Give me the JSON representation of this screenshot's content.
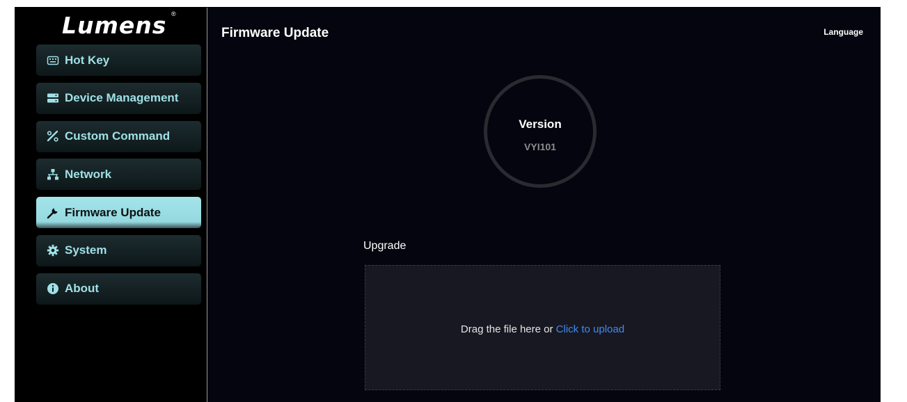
{
  "logo": {
    "text": "Lumens",
    "reg": "®"
  },
  "sidebar": {
    "items": [
      {
        "label": "Hot Key",
        "icon": "keyboard-icon",
        "active": false
      },
      {
        "label": "Device Management",
        "icon": "server-icon",
        "active": false
      },
      {
        "label": "Custom Command",
        "icon": "magic-tools-icon",
        "active": false
      },
      {
        "label": "Network",
        "icon": "network-icon",
        "active": false
      },
      {
        "label": "Firmware Update",
        "icon": "wrench-icon",
        "active": true
      },
      {
        "label": "System",
        "icon": "gear-icon",
        "active": false
      },
      {
        "label": "About",
        "icon": "info-icon",
        "active": false
      }
    ]
  },
  "header": {
    "title": "Firmware Update",
    "language_label": "Language"
  },
  "version": {
    "title": "Version",
    "value": "VYI101"
  },
  "upgrade": {
    "label": "Upgrade",
    "drop_text": "Drag the file here or ",
    "upload_link": "Click to upload"
  },
  "colors": {
    "accent": "#9fe0e6",
    "active_bg": "#a3e4ea",
    "link": "#3d8bf2",
    "background": "#05050f"
  }
}
